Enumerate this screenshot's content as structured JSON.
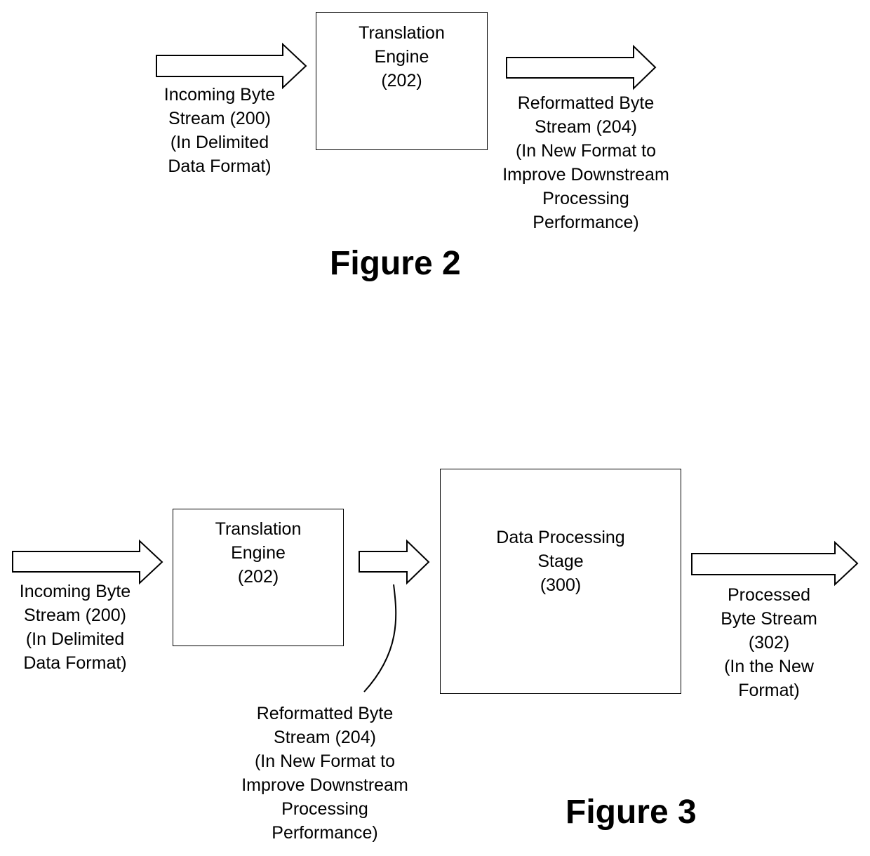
{
  "figure2": {
    "title": "Figure 2",
    "input_label": "Incoming Byte\nStream (200)\n(In Delimited\nData Format)",
    "engine_label": "Translation\nEngine\n(202)",
    "output_label": "Reformatted Byte\nStream (204)\n(In New Format to\nImprove Downstream\nProcessing\nPerformance)"
  },
  "figure3": {
    "title": "Figure 3",
    "input_label": "Incoming Byte\nStream (200)\n(In Delimited\nData Format)",
    "engine_label": "Translation\nEngine\n(202)",
    "intermediate_label": "Reformatted Byte\nStream (204)\n(In New Format to\nImprove Downstream\nProcessing\nPerformance)",
    "stage_label": "Data Processing\nStage\n(300)",
    "output_label": "Processed\nByte Stream\n(302)\n(In the New\nFormat)"
  }
}
